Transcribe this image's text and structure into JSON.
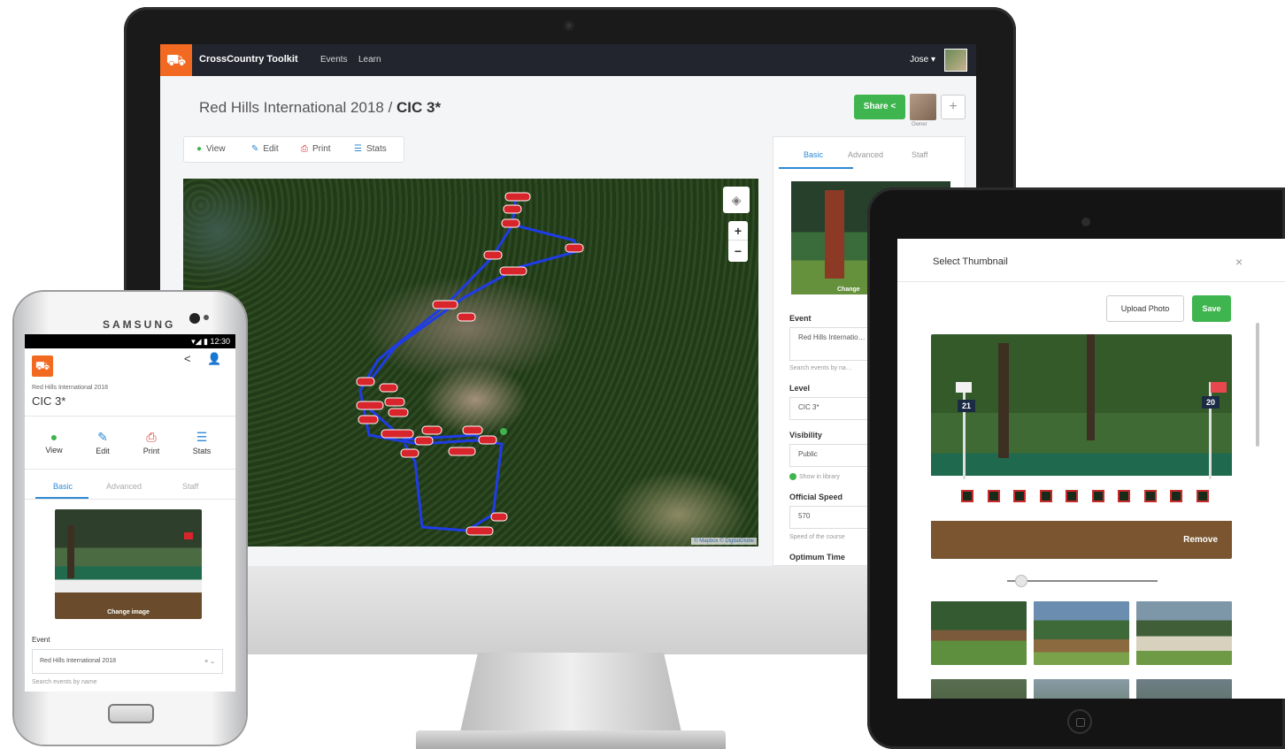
{
  "desktop": {
    "brand": "CrossCountry Toolkit",
    "nav": [
      "Events",
      "Learn"
    ],
    "user": "Jose ▾",
    "title_prefix": "Red Hills International 2018 / ",
    "title_level": "CIC 3*",
    "share_label": "Share",
    "owner_label": "Owner",
    "add_label": "+",
    "toolbar": [
      {
        "icon": "eye-icon",
        "label": "View",
        "glyph": "👁",
        "color": "#3fb54f"
      },
      {
        "icon": "edit-icon",
        "label": "Edit",
        "glyph": "✎",
        "color": "#2d8ad6"
      },
      {
        "icon": "printer-icon",
        "label": "Print",
        "glyph": "⎙",
        "color": "#d9362e"
      },
      {
        "icon": "stats-icon",
        "label": "Stats",
        "glyph": "☰",
        "color": "#2d8ad6"
      }
    ],
    "map_attribution": "© Mapbox © DigitalGlobe",
    "zoom_in": "+",
    "zoom_out": "−",
    "side_tabs": [
      "Basic",
      "Advanced",
      "Staff"
    ],
    "change_image": "Change",
    "fields": {
      "event_label": "Event",
      "event_value": "Red Hills Internatio… 2018",
      "event_help": "Search events by na…",
      "level_label": "Level",
      "level_value": "CIC 3*",
      "visibility_label": "Visibility",
      "visibility_value": "Public",
      "show_library": "Show in library",
      "speed_label": "Official Speed",
      "speed_value": "570",
      "speed_help": "Speed of the course",
      "optimum_label": "Optimum Time"
    }
  },
  "phone": {
    "brand": "SAMSUNG",
    "status": "▾◢ ▮ 12:30",
    "event": "Red Hills International 2018",
    "level": "CIC 3*",
    "actions": [
      {
        "icon": "eye-icon",
        "label": "View",
        "glyph": "👁",
        "color": "#3fb54f"
      },
      {
        "icon": "edit-icon",
        "label": "Edit",
        "glyph": "✎",
        "color": "#2d8ad6"
      },
      {
        "icon": "printer-icon",
        "label": "Print",
        "glyph": "⎙",
        "color": "#d9362e"
      },
      {
        "icon": "stats-icon",
        "label": "Stats",
        "glyph": "☰",
        "color": "#2d8ad6"
      }
    ],
    "tabs": [
      "Basic",
      "Advanced",
      "Staff"
    ],
    "change_image": "Change image",
    "event_label": "Event",
    "event_value": "Red Hills International 2018",
    "select_caret": "× ⌄",
    "event_help": "Search events by name"
  },
  "tablet": {
    "modal_title": "Select Thumbnail",
    "close": "×",
    "upload_label": "Upload Photo",
    "save_label": "Save",
    "remove_label": "Remove",
    "fence_numbers": [
      "21",
      "20"
    ],
    "zoom_level": 0.05
  },
  "colors": {
    "accent_green": "#3fb54f",
    "brand_orange": "#f26a21",
    "route_blue": "#1f3ce6",
    "tab_blue": "#2d8ad6",
    "fence_red": "#d8252c"
  }
}
